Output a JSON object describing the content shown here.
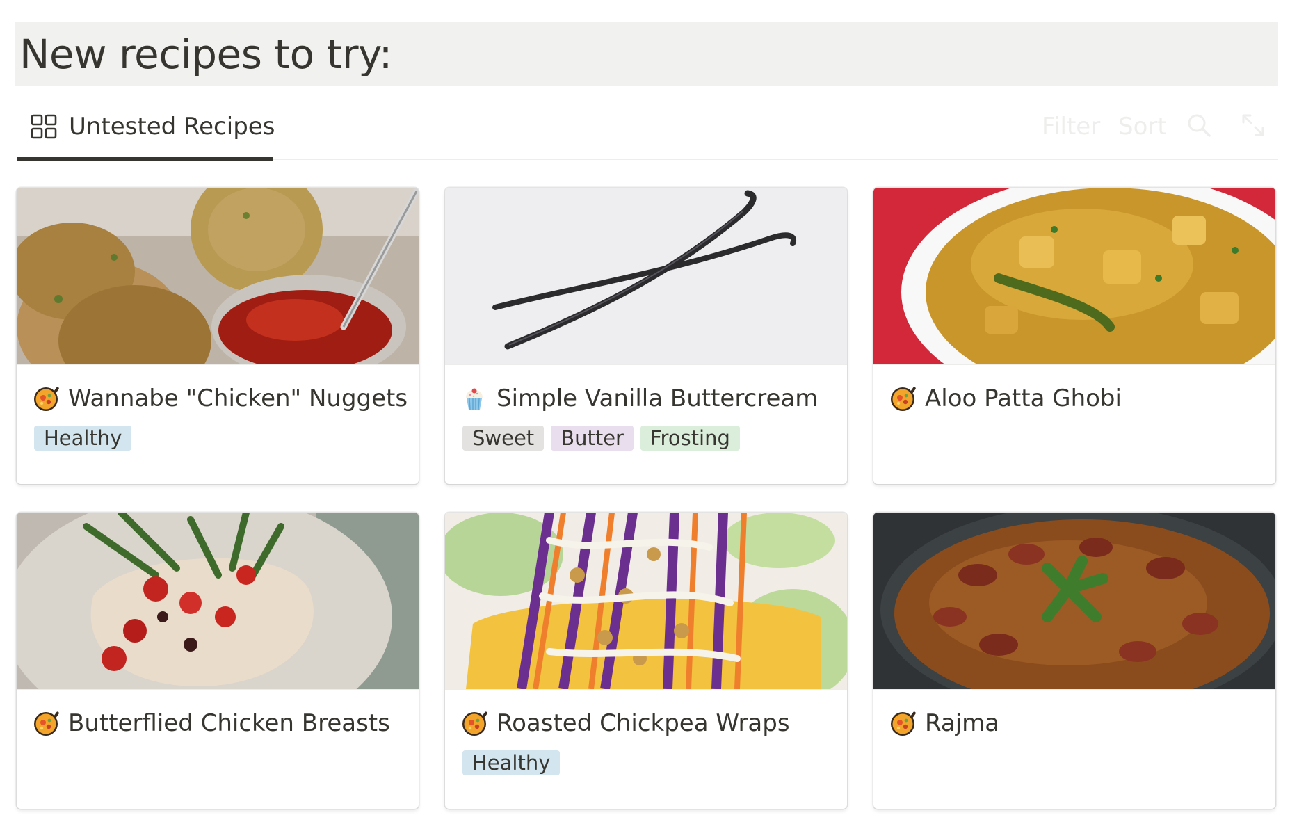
{
  "heading": "New recipes to try:",
  "view_tab": {
    "label": "Untested Recipes",
    "icon": "gallery-view-icon"
  },
  "toolbar": {
    "filter_label": "Filter",
    "sort_label": "Sort",
    "search_icon": "search-icon",
    "expand_icon": "expand-icon"
  },
  "colors": {
    "heading_background": "#f1f1ef",
    "tag_healthy": "#d3e5ef",
    "tag_sweet": "#e3e2e0",
    "tag_butter": "#e8deee",
    "tag_frosting": "#dbeddb"
  },
  "cards": [
    {
      "title": "Wannabe \"Chicken\" Nuggets",
      "icon": "paella-emoji-icon",
      "tags": [
        {
          "label": "Healthy",
          "color": "#d3e5ef"
        }
      ]
    },
    {
      "title": "Simple Vanilla Buttercream",
      "icon": "cupcake-emoji-icon",
      "tags": [
        {
          "label": "Sweet",
          "color": "#e3e2e0"
        },
        {
          "label": "Butter",
          "color": "#e8deee"
        },
        {
          "label": "Frosting",
          "color": "#dbeddb"
        }
      ]
    },
    {
      "title": "Aloo Patta Ghobi",
      "icon": "paella-emoji-icon",
      "tags": []
    },
    {
      "title": "Butterflied Chicken Breasts",
      "icon": "paella-emoji-icon",
      "tags": []
    },
    {
      "title": "Roasted Chickpea Wraps",
      "icon": "paella-emoji-icon",
      "tags": [
        {
          "label": "Healthy",
          "color": "#d3e5ef"
        }
      ]
    },
    {
      "title": "Rajma",
      "icon": "paella-emoji-icon",
      "tags": []
    }
  ]
}
